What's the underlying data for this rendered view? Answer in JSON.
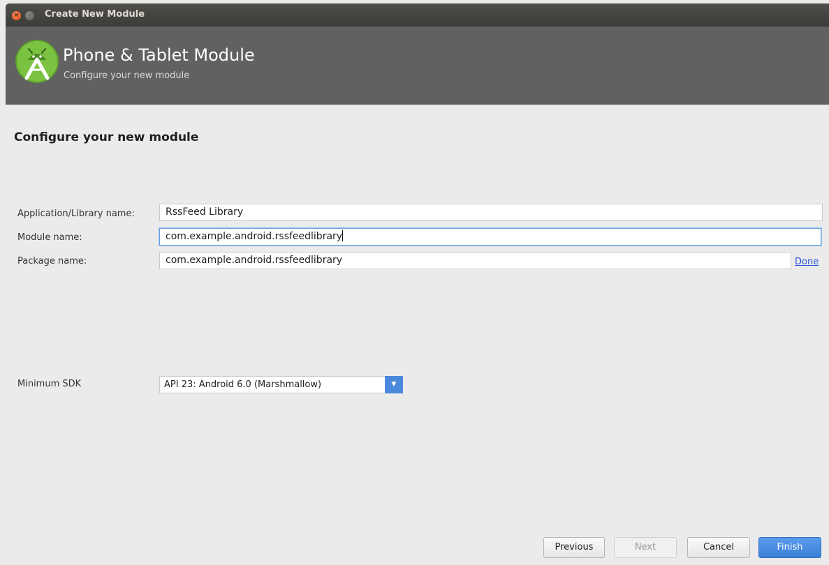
{
  "window": {
    "title": "Create New Module"
  },
  "header": {
    "title": "Phone & Tablet Module",
    "subtitle": "Configure your new module"
  },
  "section_title": "Configure your new module",
  "form": {
    "app_name": {
      "label": "Application/Library name:",
      "value": "RssFeed Library"
    },
    "module_name": {
      "label": "Module name:",
      "value": "com.example.android.rssfeedlibrary"
    },
    "package_name": {
      "label": "Package name:",
      "value": "com.example.android.rssfeedlibrary",
      "link": "Done"
    },
    "min_sdk": {
      "label": "Minimum SDK",
      "value": "API 23: Android 6.0 (Marshmallow)"
    }
  },
  "buttons": {
    "previous": "Previous",
    "next": "Next",
    "cancel": "Cancel",
    "finish": "Finish"
  },
  "colors": {
    "accent": "#4a89dc",
    "header_bg": "#616161",
    "link": "#2a55d5"
  }
}
